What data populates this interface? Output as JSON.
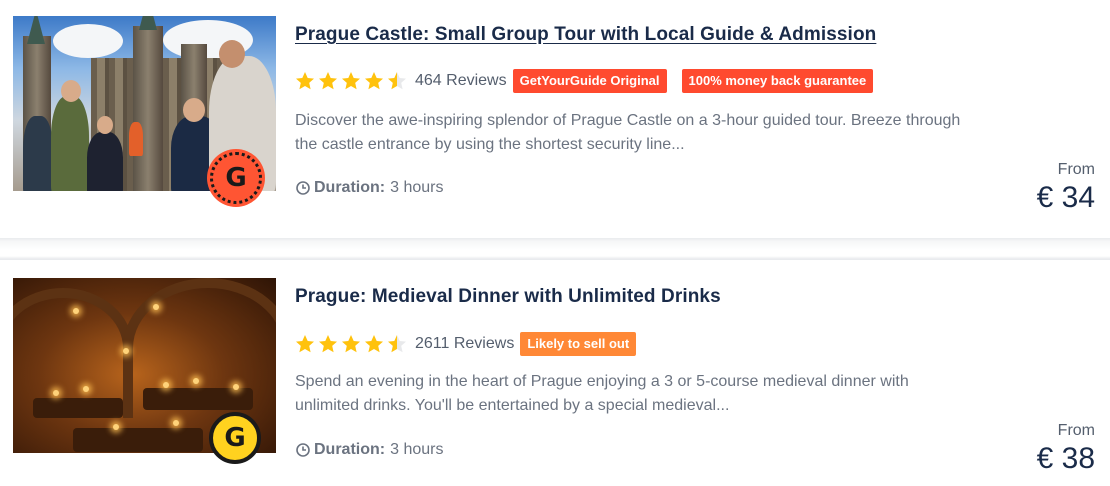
{
  "listings": [
    {
      "title": "Prague Castle: Small Group Tour with Local Guide & Admission",
      "rating": 4.5,
      "reviews": "464 Reviews",
      "tags": [
        "GetYourGuide Original",
        "100% money back guarantee"
      ],
      "description_line1": "Discover the awe-inspiring splendor of Prague Castle on a 3-hour guided tour. Breeze through",
      "description_line2": "the castle entrance by using the shortest security line...",
      "duration_label": "Duration:",
      "duration_value": "3 hours",
      "from_label": "From",
      "price": "€ 34",
      "badge_letter": "G",
      "badge_color": "#ff5533"
    },
    {
      "title": "Prague: Medieval Dinner with Unlimited Drinks",
      "rating": 4.5,
      "reviews": "2611 Reviews",
      "tags": [
        "Likely to sell out"
      ],
      "description_line1": "Spend an evening in the heart of Prague enjoying a 3 or 5-course medieval dinner with",
      "description_line2": "unlimited drinks. You'll be entertained by a special medieval...",
      "duration_label": "Duration:",
      "duration_value": "3 hours",
      "from_label": "From",
      "price": "€ 38",
      "badge_letter": "G",
      "badge_color": "#ffd21f"
    }
  ],
  "colors": {
    "star": "#ffc20d",
    "tag_red": "#ff4a2f",
    "tag_orange": "#ff8836",
    "title": "#1a2b49",
    "body_text": "#6b7380"
  }
}
